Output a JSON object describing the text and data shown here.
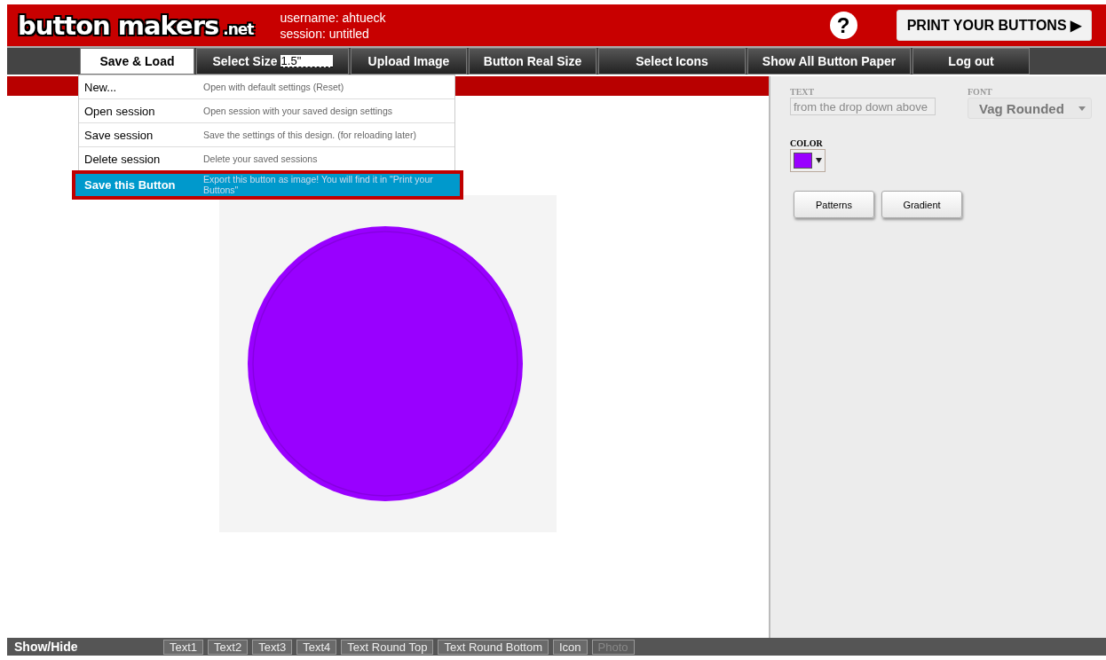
{
  "header": {
    "logo": "button makers",
    "logo_suffix": ".net",
    "username": "username: ahtueck",
    "session": "session: untitled",
    "help": "?",
    "print_button": "PRINT YOUR BUTTONS ▶"
  },
  "nav": {
    "tabs": [
      {
        "label": "Save & Load",
        "selected": true,
        "kind": "tab"
      },
      {
        "label": "Select Size",
        "selected": false,
        "kind": "size",
        "value": "1.5\""
      },
      {
        "label": "Upload Image",
        "selected": false,
        "kind": "tab"
      },
      {
        "label": "Button Real Size",
        "selected": false,
        "kind": "tab"
      },
      {
        "label": "Select Icons",
        "selected": false,
        "kind": "tab"
      },
      {
        "label": "Show All Button Paper",
        "selected": false,
        "kind": "tab"
      },
      {
        "label": "Log out",
        "selected": false,
        "kind": "tab"
      }
    ]
  },
  "menu": {
    "items": [
      {
        "label": "New...",
        "description": "Open with default settings (Reset)",
        "selected": false
      },
      {
        "label": "Open session",
        "description": "Open session with your saved design settings",
        "selected": false
      },
      {
        "label": "Save session",
        "description": "Save the settings of this design. (for reloading later)",
        "selected": false
      },
      {
        "label": "Delete session",
        "description": "Delete your saved sessions",
        "selected": false
      },
      {
        "label": "Save this Button",
        "description": "Export this button as image! You will find it in \"Print your Buttons\"",
        "selected": true
      }
    ]
  },
  "panel": {
    "text": {
      "label": "TEXT",
      "placeholder": "from the drop down above",
      "disabled": true
    },
    "font": {
      "label": "FONT",
      "value": "Vag Rounded",
      "disabled": true
    },
    "color": {
      "label": "COLOR",
      "color": "#9900ff"
    },
    "buttons": [
      "Patterns",
      "Gradient"
    ]
  },
  "footer": {
    "label": "Show/Hide",
    "toggles": [
      {
        "label": "Text1",
        "disabled": false
      },
      {
        "label": "Text2",
        "disabled": false
      },
      {
        "label": "Text3",
        "disabled": false
      },
      {
        "label": "Text4",
        "disabled": false
      },
      {
        "label": "Text Round Top",
        "disabled": false
      },
      {
        "label": "Text Round Bottom",
        "disabled": false
      },
      {
        "label": "Icon",
        "disabled": false
      },
      {
        "label": "Photo",
        "disabled": true
      }
    ]
  }
}
